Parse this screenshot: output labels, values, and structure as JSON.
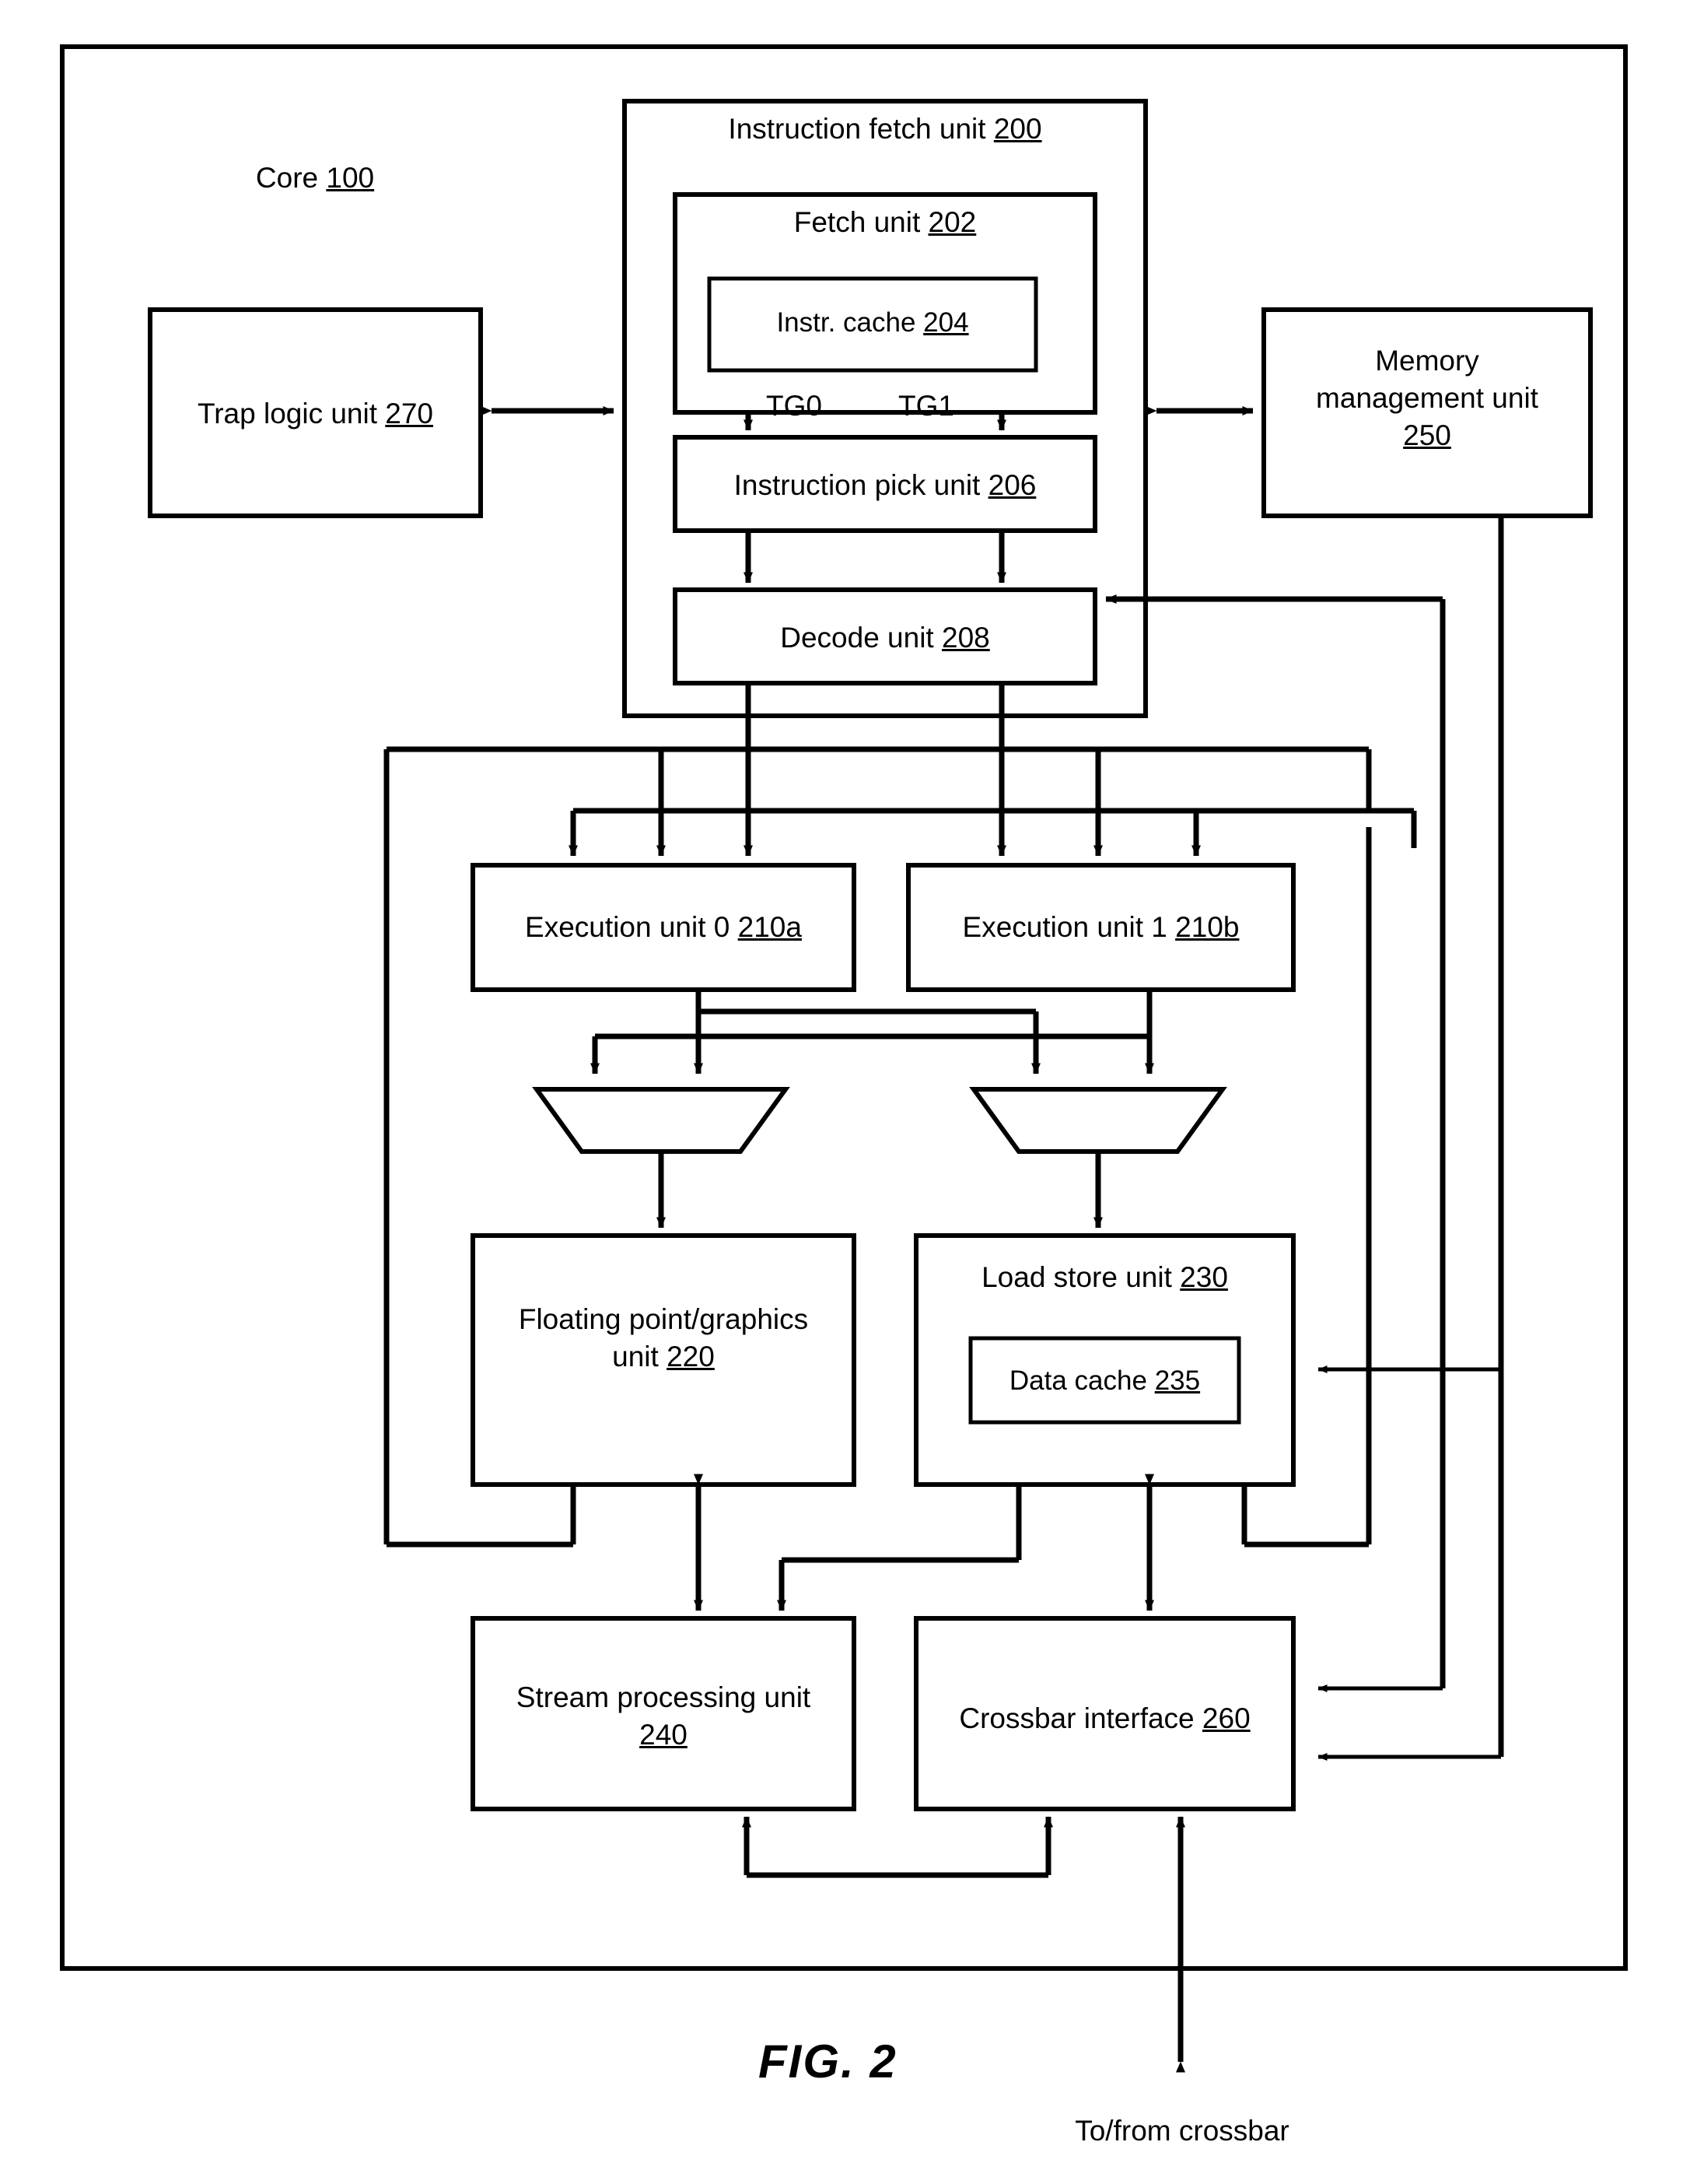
{
  "figure": {
    "caption": "FIG. 2",
    "external_label": "To/from crossbar"
  },
  "core": {
    "label": "Core",
    "ref": "100"
  },
  "blocks": {
    "instruction_fetch_unit": {
      "label": "Instruction fetch unit",
      "ref": "200"
    },
    "fetch_unit": {
      "label": "Fetch unit",
      "ref": "202"
    },
    "instr_cache": {
      "label": "Instr. cache",
      "ref": "204"
    },
    "instruction_pick_unit": {
      "label": "Instruction pick unit",
      "ref": "206"
    },
    "decode_unit": {
      "label": "Decode unit",
      "ref": "208"
    },
    "trap_logic_unit": {
      "label": "Trap logic unit",
      "ref": "270"
    },
    "memory_management_unit": {
      "label_line1": "Memory",
      "label_line2": "management unit",
      "ref": "250"
    },
    "execution_unit_0": {
      "label": "Execution unit 0",
      "ref": "210a"
    },
    "execution_unit_1": {
      "label": "Execution unit 1",
      "ref": "210b"
    },
    "fp_graphics_unit": {
      "label_line1": "Floating point/graphics",
      "label_line2": "unit",
      "ref": "220"
    },
    "load_store_unit": {
      "label": "Load store unit",
      "ref": "230"
    },
    "data_cache": {
      "label": "Data cache",
      "ref": "235"
    },
    "stream_processing_unit": {
      "label_line1": "Stream processing unit",
      "ref": "240"
    },
    "crossbar_interface": {
      "label": "Crossbar interface",
      "ref": "260"
    }
  },
  "signals": {
    "tg0": "TG0",
    "tg1": "TG1"
  },
  "style": {
    "line_color": "#000000",
    "fill_color": "#ffffff"
  }
}
